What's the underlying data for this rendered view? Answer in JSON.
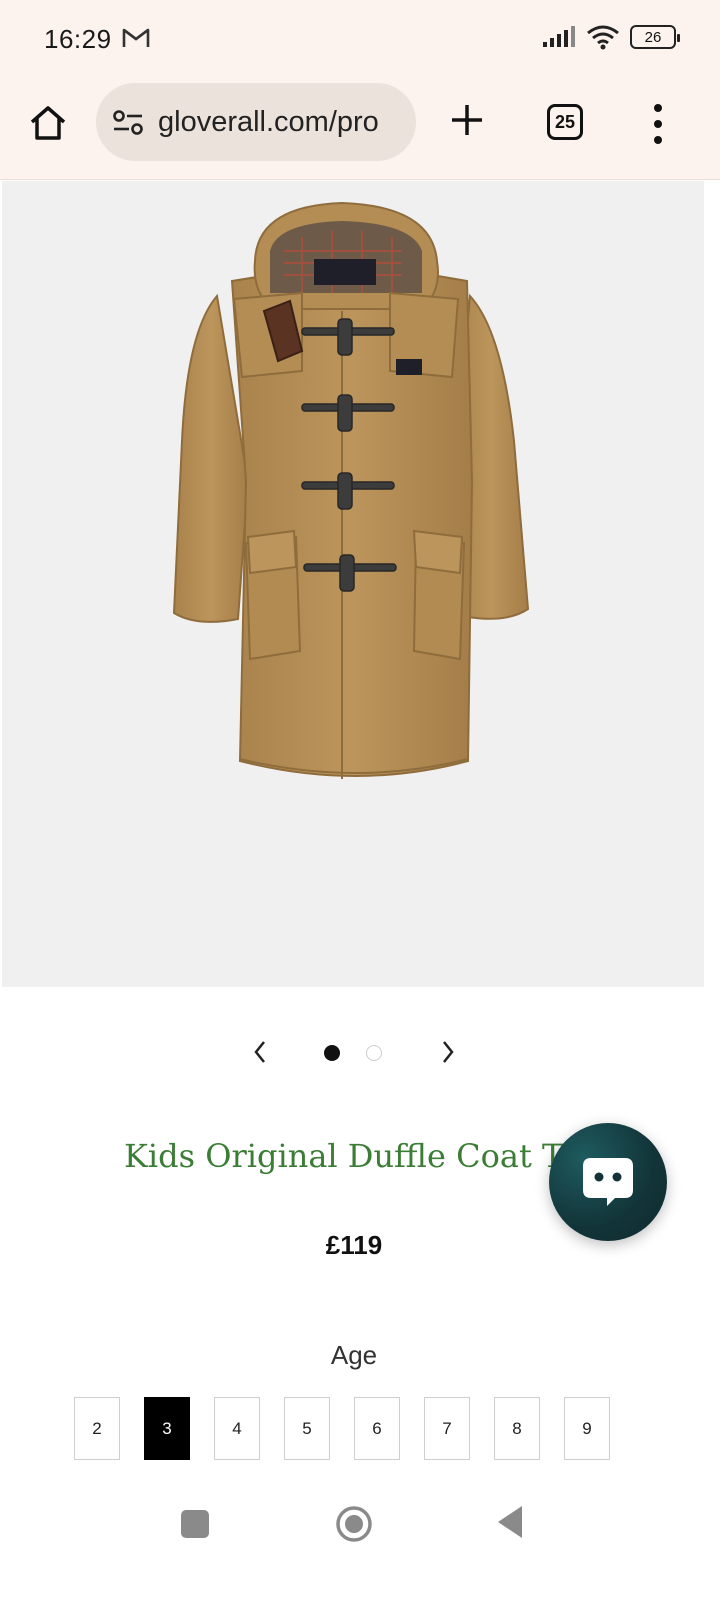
{
  "status_bar": {
    "time": "16:29",
    "notification_icon": "gmail-icon",
    "battery": "26"
  },
  "browser": {
    "url": "gloverall.com/pro",
    "tab_count": "25",
    "icons": [
      "home-icon",
      "site-settings-icon",
      "plus-icon",
      "tabs-icon",
      "more-vert-icon"
    ]
  },
  "product": {
    "image_alt": "camel duffle coat",
    "title": "Kids Original Duffle Coat Ta",
    "price": "£119",
    "coat_color": "#b9925a"
  },
  "carousel": {
    "prev_icon": "chevron-left-icon",
    "next_icon": "chevron-right-icon",
    "active_index": 0,
    "slide_count": 2
  },
  "age": {
    "label": "Age",
    "options": [
      "2",
      "3",
      "4",
      "5",
      "6",
      "7",
      "8",
      "9"
    ],
    "selected": "3"
  },
  "chat": {
    "icon": "chat-bubble-icon",
    "accent": "#123438"
  },
  "nav_bar": {
    "icons": [
      "recents-icon",
      "home-circle-icon",
      "back-triangle-icon"
    ]
  }
}
